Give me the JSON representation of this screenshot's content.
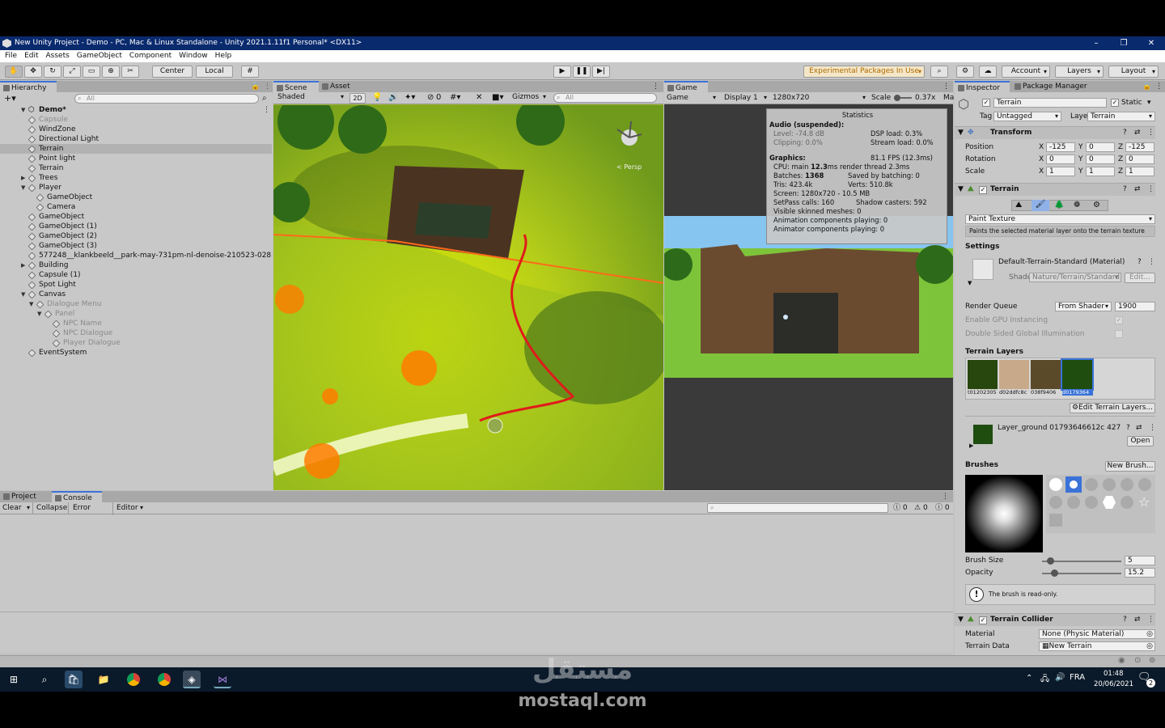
{
  "window": {
    "title": "New Unity Project - Demo - PC, Mac & Linux Standalone - Unity 2021.1.11f1 Personal* <DX11>"
  },
  "menu": [
    "File",
    "Edit",
    "Assets",
    "GameObject",
    "Component",
    "Window",
    "Help"
  ],
  "toolbar": {
    "pivot": "Center",
    "space": "Local",
    "experimental": "Experimental Packages In Use",
    "account": "Account",
    "layers": "Layers",
    "layout": "Layout"
  },
  "hierarchy": {
    "tab": "Hierarchy",
    "search_placeholder": "All",
    "scene": "Demo*",
    "items": [
      {
        "label": "Capsule",
        "indent": 1,
        "dim": true
      },
      {
        "label": "WindZone",
        "indent": 1
      },
      {
        "label": "Directional Light",
        "indent": 1
      },
      {
        "label": "Terrain",
        "indent": 1,
        "selected": true
      },
      {
        "label": "Point light",
        "indent": 1
      },
      {
        "label": "Terrain",
        "indent": 1
      },
      {
        "label": "Trees",
        "indent": 1,
        "arrow": "right"
      },
      {
        "label": "Player",
        "indent": 1,
        "arrow": "down"
      },
      {
        "label": "GameObject",
        "indent": 2
      },
      {
        "label": "Camera",
        "indent": 2
      },
      {
        "label": "GameObject",
        "indent": 1
      },
      {
        "label": "GameObject (1)",
        "indent": 1
      },
      {
        "label": "GameObject (2)",
        "indent": 1
      },
      {
        "label": "GameObject (3)",
        "indent": 1
      },
      {
        "label": "577248__klankbeeld__park-may-731pm-nl-denoise-210523-028",
        "indent": 1
      },
      {
        "label": "Building",
        "indent": 1,
        "arrow": "right"
      },
      {
        "label": "Capsule (1)",
        "indent": 1
      },
      {
        "label": "Spot Light",
        "indent": 1
      },
      {
        "label": "Canvas",
        "indent": 1,
        "arrow": "down"
      },
      {
        "label": "Dialogue Menu",
        "indent": 2,
        "arrow": "down",
        "dim": true
      },
      {
        "label": "Panel",
        "indent": 3,
        "arrow": "down",
        "dim": true
      },
      {
        "label": "NPC Name",
        "indent": 4,
        "dim": true
      },
      {
        "label": "NPC Dialogue",
        "indent": 4,
        "dim": true
      },
      {
        "label": "Player Dialogue",
        "indent": 4,
        "dim": true
      },
      {
        "label": "EventSystem",
        "indent": 1
      }
    ]
  },
  "scene": {
    "tab_scene": "Scene",
    "tab_store": "Asset Store",
    "shading": "Shaded",
    "mode2d": "2D",
    "gizmos": "Gizmos",
    "search_placeholder": "All",
    "hidden_count": "0",
    "persp": "< Persp"
  },
  "game": {
    "tab": "Game",
    "view": "Game",
    "display": "Display 1",
    "resolution": "1280x720",
    "scale_label": "Scale",
    "scale_value": "0.37x",
    "maximize": "Ma"
  },
  "stats": {
    "title": "Statistics",
    "audio_header": "Audio (suspended):",
    "audio_level": "Level: -74.8 dB",
    "audio_clipping": "Clipping: 0.0%",
    "dsp_load": "DSP load: 0.3%",
    "stream_load": "Stream load: 0.0%",
    "graphics_header": "Graphics:",
    "fps": "81.1 FPS (12.3ms)",
    "cpu_prefix": "CPU: main ",
    "cpu_main": "12.3",
    "cpu_suffix": "ms  render thread 2.3ms",
    "batches_prefix": "Batches: ",
    "batches": "1368",
    "batching": "Saved by batching: 0",
    "tris": "Tris: 423.4k",
    "verts": "Verts: 510.8k",
    "screen": "Screen: 1280x720 - 10.5 MB",
    "setpass": "SetPass calls: 160",
    "shadow": "Shadow casters: 592",
    "skinned": "Visible skinned meshes: 0",
    "anim": "Animation components playing: 0",
    "animator": "Animator components playing: 0"
  },
  "console": {
    "tab_project": "Project",
    "tab_console": "Console",
    "clear": "Clear",
    "collapse": "Collapse",
    "error_pause": "Error Pause",
    "editor": "Editor",
    "count_log": "0",
    "count_warn": "0",
    "count_err": "0"
  },
  "inspector": {
    "tab": "Inspector",
    "tab_pm": "Package Manager",
    "name": "Terrain",
    "static_label": "Static",
    "tag_label": "Tag",
    "tag_value": "Untagged",
    "layer_label": "Layer",
    "layer_value": "Terrain",
    "transform": {
      "title": "Transform",
      "position_label": "Position",
      "rotation_label": "Rotation",
      "scale_label": "Scale",
      "position": [
        "-125",
        "0",
        "-125"
      ],
      "rotation": [
        "0",
        "0",
        "0"
      ],
      "scale": [
        "1",
        "1",
        "1"
      ]
    },
    "terrain": {
      "title": "Terrain",
      "tool": "Paint Texture",
      "tool_desc": "Paints the selected material layer onto the terrain texture",
      "settings": "Settings",
      "material": "Default-Terrain-Standard (Material)",
      "shader_label": "Shader",
      "shader_value": "Nature/Terrain/Standard",
      "edit": "Edit...",
      "render_queue_label": "Render Queue",
      "render_queue_mode": "From Shader",
      "render_queue_value": "1900",
      "gpu_instancing": "Enable GPU Instancing",
      "double_sided": "Double Sided Global Illumination",
      "layers_title": "Terrain Layers",
      "layer_names": [
        "t01202305",
        "d02ddfc8c",
        "038f9406",
        "d0179364"
      ],
      "edit_layers": "Edit Terrain Layers...",
      "layer_ground": "Layer_ground 01793646612c 427",
      "open": "Open",
      "brushes": "Brushes",
      "new_brush": "New Brush...",
      "brush_size_label": "Brush Size",
      "brush_size": "5",
      "brush_size_fraction": 0.1,
      "opacity_label": "Opacity",
      "opacity": "15.2",
      "opacity_fraction": 0.152,
      "readonly": "The brush is read-only."
    },
    "collider": {
      "title": "Terrain Collider",
      "material_label": "Material",
      "material_value": "None (Physic Material)",
      "data_label": "Terrain Data",
      "data_value": "New Terrain"
    }
  },
  "taskbar": {
    "lang": "FRA",
    "time": "01:48",
    "date": "20/06/2021",
    "notif": "2"
  },
  "watermark": {
    "arabic": "مستقل",
    "latin": "mostaql.com"
  }
}
